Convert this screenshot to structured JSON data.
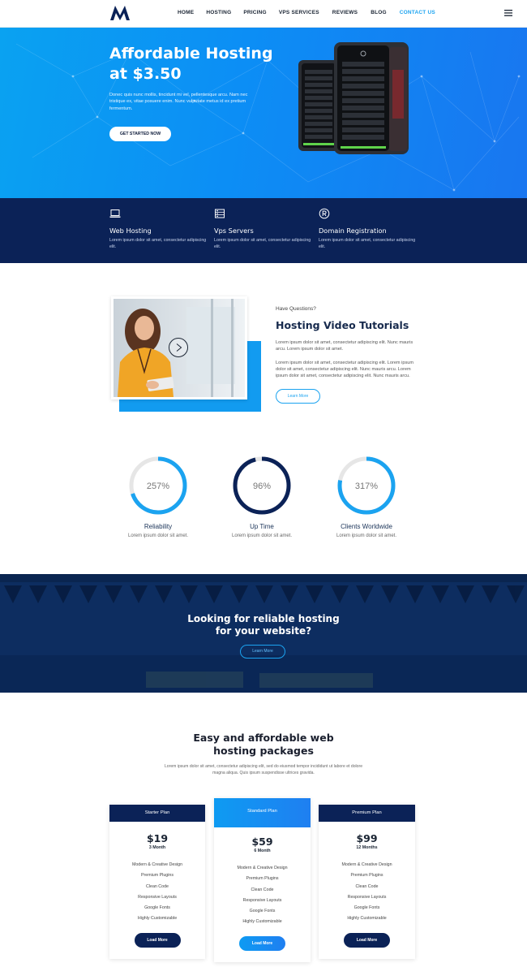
{
  "nav": {
    "items": [
      "HOME",
      "HOSTING",
      "PRICING",
      "VPS SERVICES",
      "REVIEWS",
      "BLOG",
      "CONTACT US"
    ],
    "active_index": 6,
    "accent_color": "#1ba3f0"
  },
  "hero": {
    "title": "Affordable Hosting at $3.50",
    "text": "Donec quis nunc mollis, tincidunt mi vel, pellentesque arcu. Nam nec tristique ex, vitae posuere enim. Nunc vulputate metus id ex pretium fermentum.",
    "button": "GET STARTED NOW",
    "background_color": "#0c8ef5"
  },
  "features": [
    {
      "icon": "laptop-icon",
      "title": "Web Hosting",
      "text": "Lorem ipsum dolor sit amet, consectetur adipiscing elit."
    },
    {
      "icon": "server-icon",
      "title": "Vps Servers",
      "text": "Lorem ipsum dolor sit amet, consectetur adipiscing elit."
    },
    {
      "icon": "registered-icon",
      "title": "Domain Registration",
      "text": "Lorem ipsum dolor sit amet, consectetur adipiscing elit."
    }
  ],
  "video": {
    "eyebrow": "Have Questions?",
    "title": "Hosting Video Tutorials",
    "paragraph1": "Lorem ipsum dolor sit amet, consectetur adipiscing elit. Nunc mauris arcu. Lorem ipsum dolor sit amet.",
    "paragraph2": "Lorem ipsum dolor sit amet, consectetur adipiscing elit. Lorem ipsum dolor sit amet, consectetur adipiscing elit. Nunc mauris arcu. Lorem ipsum dolor sit amet, consectetur adipiscing elit. Nunc mauris arcu.",
    "button": "Learn More"
  },
  "stats": [
    {
      "value": "257%",
      "fill": 0.7,
      "label": "Reliability",
      "sub": "Lorem ipsum dolor sit amet.",
      "color": "#1ba3f0"
    },
    {
      "value": "96%",
      "fill": 0.96,
      "label": "Up Time",
      "sub": "Lorem ipsum dolor sit amet.",
      "color": "#0b2257"
    },
    {
      "value": "317%",
      "fill": 0.78,
      "label": "Clients Worldwide",
      "sub": "Lorem ipsum dolor sit amet.",
      "color": "#1ba3f0"
    }
  ],
  "cta": {
    "title_line1": "Looking for reliable hosting",
    "title_line2": "for your website?",
    "button": "Learn More"
  },
  "pricing": {
    "title_line1": "Easy and affordable web",
    "title_line2": "hosting packages",
    "subtitle": "Lorem ipsum dolor sit amet, consectetur adipiscing elit, sed do eiusmod tempor incididunt ut labore et dolore magna aliqua. Quis ipsum suspendisse ultrices gravida.",
    "plans": [
      {
        "name": "Starter Plan",
        "price": "$19",
        "period": "3 Month",
        "features": [
          "Modern & Creative Design",
          "Premium Plugins",
          "Clean Code",
          "Responsive Layouts",
          "Google Fonts",
          "Highly Customizable"
        ],
        "button": "Load More"
      },
      {
        "name": "Standard Plan",
        "price": "$59",
        "period": "6 Month",
        "features": [
          "Modern & Creative Design",
          "Premium Plugins",
          "Clean Code",
          "Responsive Layouts",
          "Google Fonts",
          "Highly Customizable"
        ],
        "button": "Load More"
      },
      {
        "name": "Premium Plan",
        "price": "$99",
        "period": "12 Months",
        "features": [
          "Modern & Creative Design",
          "Premium Plugins",
          "Clean Code",
          "Responsive Layouts",
          "Google Fonts",
          "Highly Customizable"
        ],
        "button": "Load More"
      }
    ]
  }
}
